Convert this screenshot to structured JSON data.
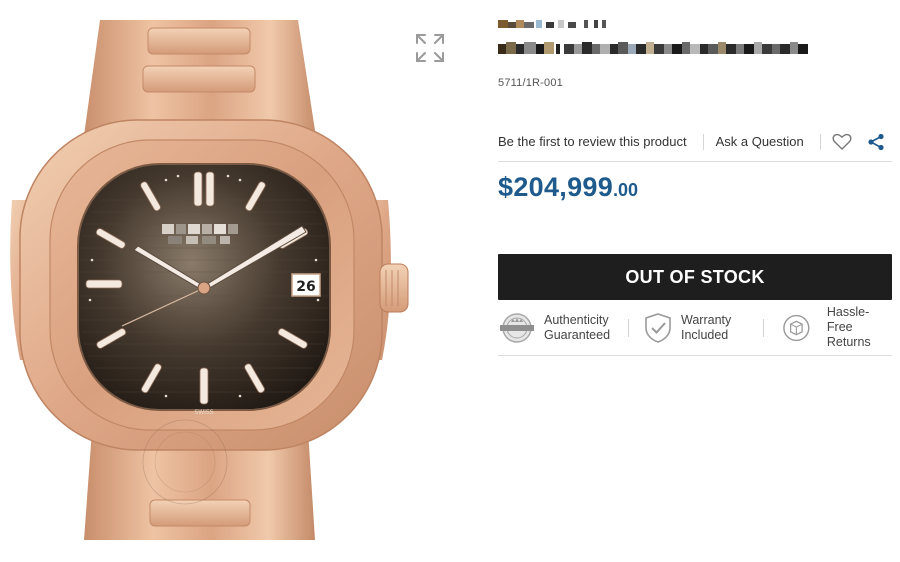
{
  "product": {
    "sku": "5711/1R-001",
    "review_link": "Be the first to review this product",
    "ask_question": "Ask a Question",
    "price_main": "$204,999",
    "price_cents": ".00",
    "stock_button": "OUT OF STOCK"
  },
  "badges": [
    {
      "line1": "Authenticity",
      "line2": "Guaranteed",
      "icon": "authentic-seal-icon"
    },
    {
      "line1": "Warranty",
      "line2": "Included",
      "icon": "warranty-shield-icon"
    },
    {
      "line1": "Hassle-Free",
      "line2": "Returns",
      "icon": "returns-box-icon"
    }
  ],
  "dial": {
    "date": "26",
    "swiss": "SWISS"
  },
  "colors": {
    "price": "#1e5a8c",
    "button": "#1e1e1e",
    "rose_gold": "#d9a483",
    "share": "#1e5a8c"
  }
}
